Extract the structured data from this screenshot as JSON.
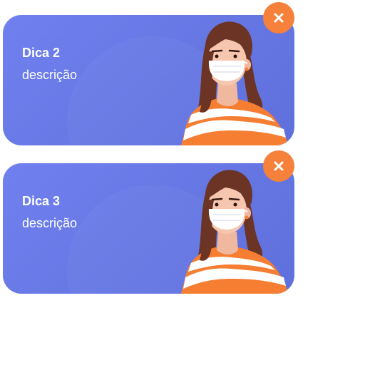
{
  "tips": [
    {
      "title": "Dica 2",
      "description": "descrição"
    },
    {
      "title": "Dica 3",
      "description": "descrição"
    }
  ],
  "icons": {
    "close": "close-icon",
    "illustration": "woman-with-mask-illustration"
  },
  "colors": {
    "card": "#6b7ce8",
    "close_button": "#f5813a",
    "text": "#ffffff"
  }
}
